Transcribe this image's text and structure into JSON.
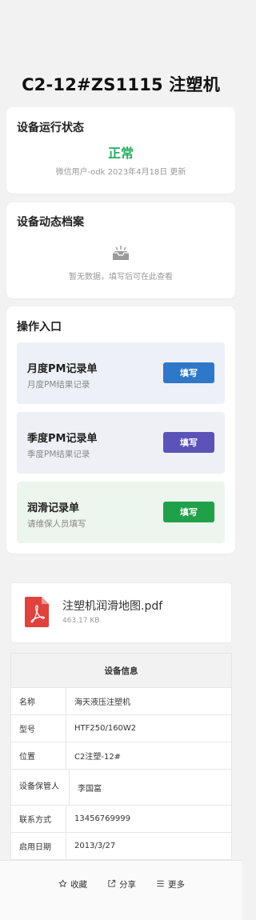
{
  "page": {
    "title": "C2-12#ZS1115 注塑机"
  },
  "status_card": {
    "title": "设备运行状态",
    "status": "正常",
    "status_color": "#27ae60",
    "meta": "微信用户-odk 2023年4月18日 更新"
  },
  "archive_card": {
    "title": "设备动态档案",
    "empty_icon": "inbox-empty-icon",
    "empty_text": "暂无数据，填写后可在此查看"
  },
  "operations": {
    "title": "操作入口",
    "items": [
      {
        "name": "月度PM记录单",
        "desc": "月度PM结果记录",
        "button": "填写",
        "bg_color": "#edf1f7",
        "button_color": "#2f77c9"
      },
      {
        "name": "季度PM记录单",
        "desc": "季度PM结果记录",
        "button": "填写",
        "bg_color": "#efeff6",
        "button_color": "#5a54b8"
      },
      {
        "name": "润滑记录单",
        "desc": "请维保人员填写",
        "button": "填写",
        "bg_color": "#ecf5ee",
        "button_color": "#21a04a"
      }
    ]
  },
  "attachment": {
    "icon": "pdf-icon",
    "name": "注塑机润滑地图.pdf",
    "size": "463.17 KB"
  },
  "device_info": {
    "title": "设备信息",
    "rows": [
      {
        "label": "名称",
        "value": "海天液压注塑机"
      },
      {
        "label": "型号",
        "value": "HTF250/160W2"
      },
      {
        "label": "位置",
        "value": "C2注塑-12#"
      },
      {
        "label": "设备保管人",
        "value": "李国富"
      },
      {
        "label": "联系方式",
        "value": "13456769999"
      },
      {
        "label": "启用日期",
        "value": "2013/3/27"
      }
    ]
  },
  "bottom_bar": {
    "favorite": {
      "label": "收藏",
      "icon": "star-icon"
    },
    "share": {
      "label": "分享",
      "icon": "share-icon"
    },
    "more": {
      "label": "更多",
      "icon": "menu-icon"
    }
  }
}
